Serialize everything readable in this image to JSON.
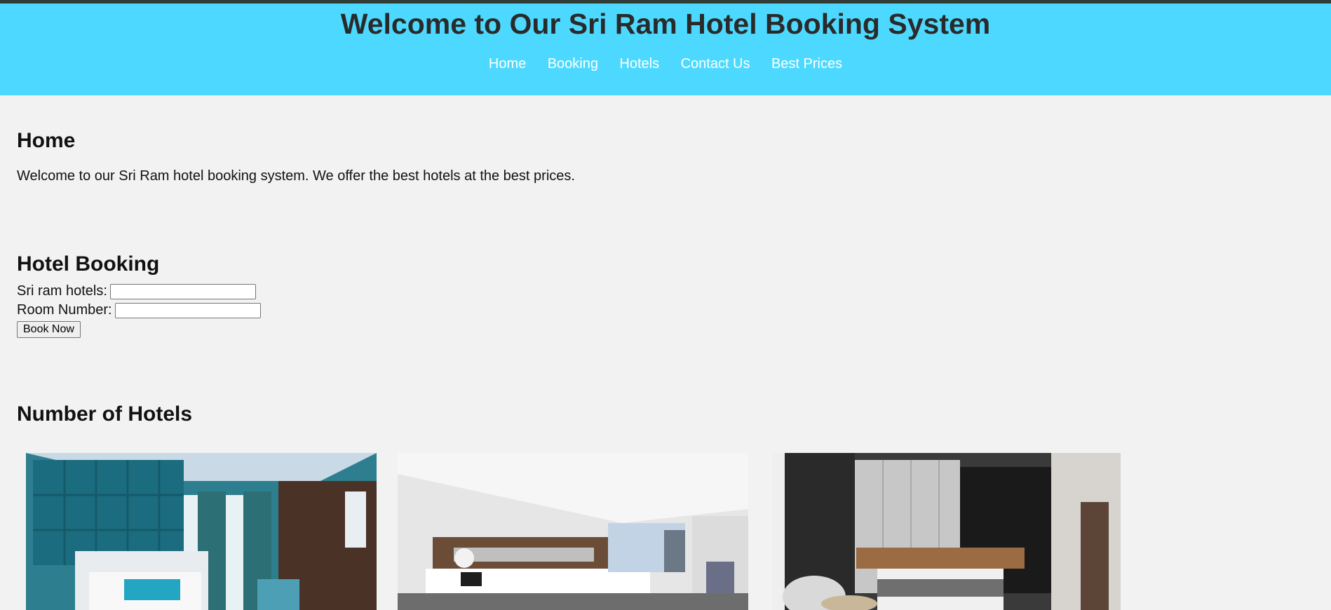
{
  "header": {
    "title": "Welcome to Our Sri Ram Hotel Booking System",
    "nav": [
      "Home",
      "Booking",
      "Hotels",
      "Contact Us",
      "Best Prices"
    ]
  },
  "home": {
    "heading": "Home",
    "text": "Welcome to our Sri Ram hotel booking system. We offer the best hotels at the best prices."
  },
  "booking": {
    "heading": "Hotel Booking",
    "hotel_label": "Sri ram hotels:",
    "hotel_value": "",
    "room_label": "Room Number:",
    "room_value": "",
    "button": "Book Now"
  },
  "hotels": {
    "heading": "Number of Hotels"
  },
  "colors": {
    "header_bg": "#4dd9ff",
    "page_bg": "#f2f2f2"
  }
}
